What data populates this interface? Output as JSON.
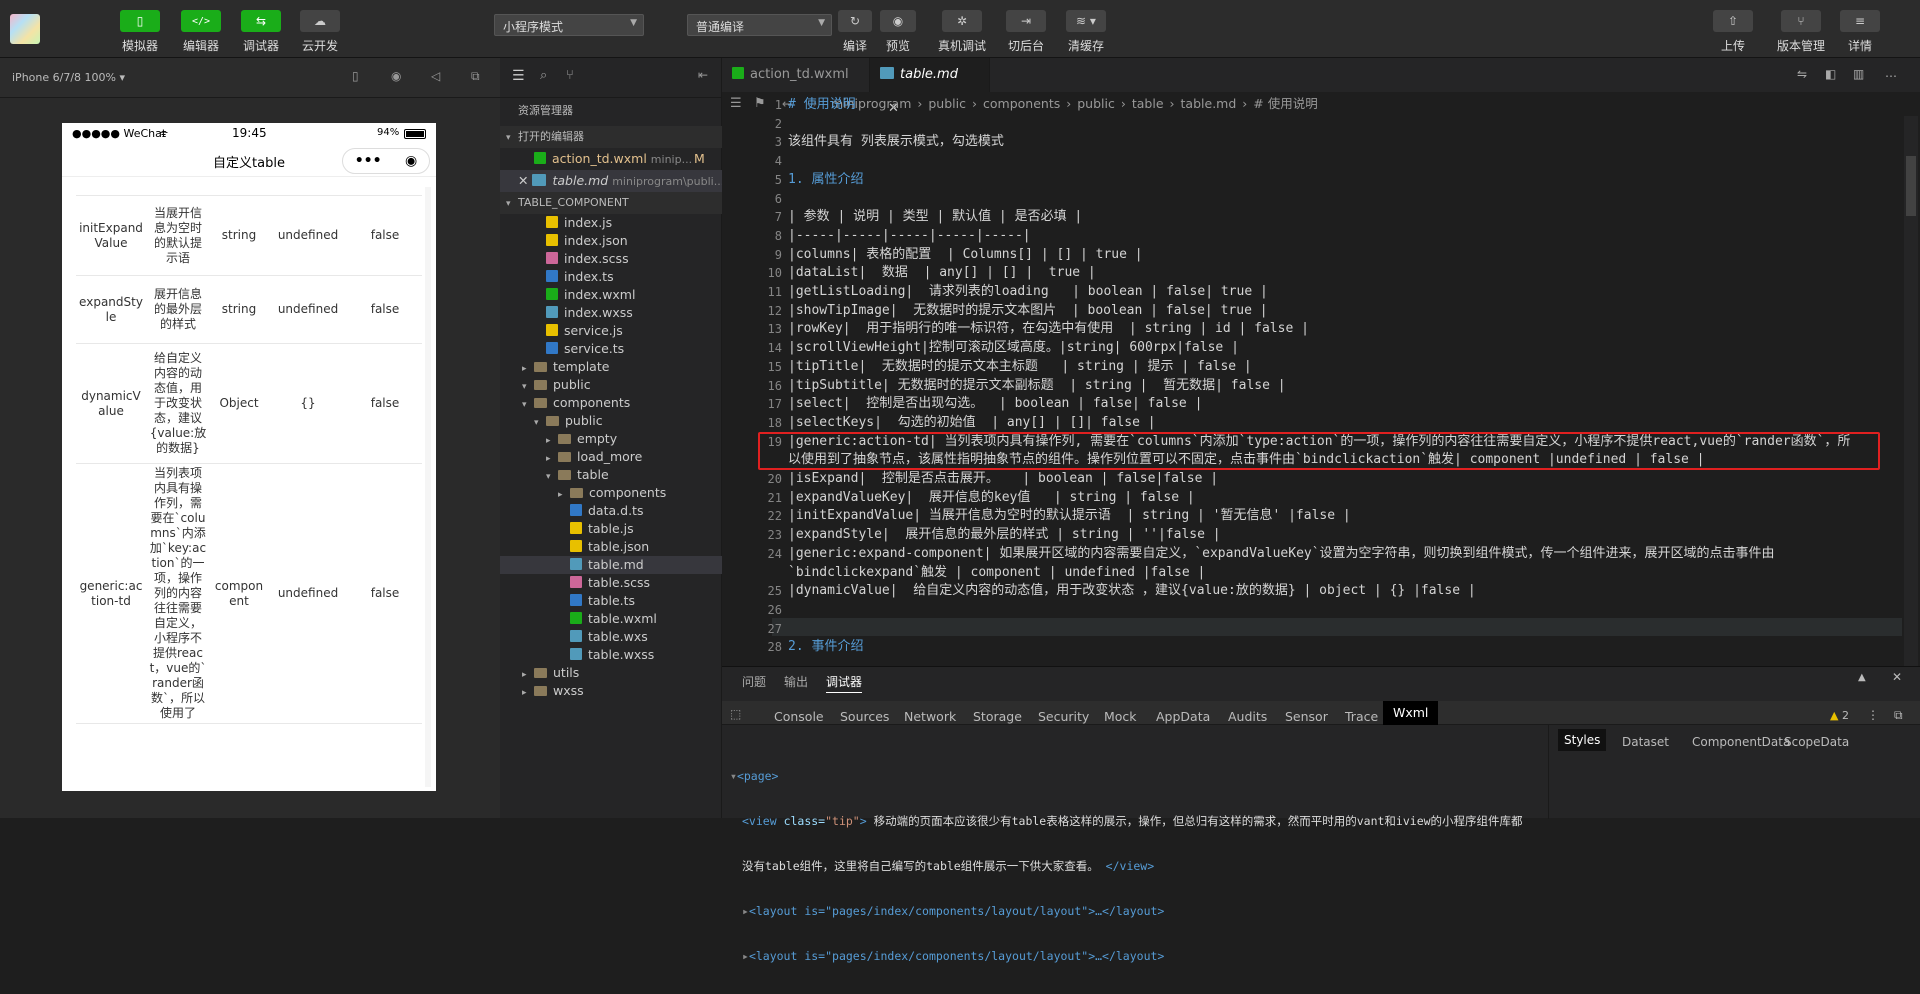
{
  "toolbar": {
    "simulator": "模拟器",
    "editor": "编辑器",
    "debugger": "调试器",
    "cloud": "云开发",
    "mode_select": "小程序模式",
    "compile_select": "普通编译",
    "compile": "编译",
    "preview": "预览",
    "real_debug": "真机调试",
    "background": "切后台",
    "clear_cache": "清缓存",
    "upload": "上传",
    "version": "版本管理",
    "details": "详情"
  },
  "simulator": {
    "device": "iPhone 6/7/8 100% ▾",
    "status": {
      "carrier": "●●●●● WeChat",
      "time": "19:45",
      "battery": "94%"
    },
    "nav_title": "自定义table",
    "rows": [
      {
        "name": "initExpandValue",
        "desc": "当展开信息为空时的默认提示语",
        "type": "string",
        "default": "undefined",
        "required": "false"
      },
      {
        "name": "expandStyle",
        "desc": "展开信息的最外层的样式",
        "type": "string",
        "default": "undefined",
        "required": "false"
      },
      {
        "name": "dynamicValue",
        "desc": "给自定义内容的动态值，用于改变状态，建议{value:放的数据}",
        "type": "Object",
        "default": "{}",
        "required": "false"
      },
      {
        "name": "generic:action-td",
        "desc": "当列表项内具有操作列，需要在`columns`内添加`key:action`的一项，操作列的内容往往需要自定义，小程序不提供react，vue的`rander函数`，所以使用了",
        "type": "component",
        "default": "undefined",
        "required": "false"
      }
    ]
  },
  "explorer": {
    "title": "资源管理器",
    "open_editors": "打开的编辑器",
    "open_files": [
      {
        "name": "action_td.wxml",
        "path": "minip...",
        "badge": "M"
      },
      {
        "name": "table.md",
        "path": "miniprogram\\publi..."
      }
    ],
    "project": "TABLE_COMPONENT",
    "tree": [
      "index.js",
      "index.json",
      "index.scss",
      "index.ts",
      "index.wxml",
      "index.wxss",
      "service.js",
      "service.ts",
      "template",
      "public",
      "components",
      "public",
      "empty",
      "load_more",
      "table",
      "components",
      "data.d.ts",
      "table.js",
      "table.json",
      "table.md",
      "table.scss",
      "table.ts",
      "table.wxml",
      "table.wxs",
      "table.wxss",
      "utils",
      "wxss"
    ]
  },
  "editor": {
    "tabs": [
      "action_td.wxml",
      "table.md"
    ],
    "breadcrumb": [
      "miniprogram",
      "public",
      "components",
      "public",
      "table",
      "table.md",
      "# 使用说明"
    ],
    "lines": [
      {
        "n": "1",
        "t": "# 使用说明"
      },
      {
        "n": "2",
        "t": ""
      },
      {
        "n": "3",
        "t": "该组件具有 列表展示模式，勾选模式"
      },
      {
        "n": "4",
        "t": ""
      },
      {
        "n": "5",
        "t": "1. 属性介绍"
      },
      {
        "n": "6",
        "t": ""
      },
      {
        "n": "7",
        "t": "| 参数 | 说明 | 类型 | 默认值 | 是否必填 |"
      },
      {
        "n": "8",
        "t": "|-----|-----|-----|-----|-----|"
      },
      {
        "n": "9",
        "t": "|columns| 表格的配置  | Columns[] | [] | true |"
      },
      {
        "n": "10",
        "t": "|dataList|  数据  | any[] | [] |  true |"
      },
      {
        "n": "11",
        "t": "|getListLoading|  请求列表的loading   | boolean | false| true |"
      },
      {
        "n": "12",
        "t": "|showTipImage|  无数据时的提示文本图片  | boolean | false| true |"
      },
      {
        "n": "13",
        "t": "|rowKey|  用于指明行的唯一标识符，在勾选中有使用  | string | id | false |"
      },
      {
        "n": "14",
        "t": "|scrollViewHeight|控制可滚动区域高度。|string| 600rpx|false |"
      },
      {
        "n": "15",
        "t": "|tipTitle|  无数据时的提示文本主标题   | string | 提示 | false |"
      },
      {
        "n": "16",
        "t": "|tipSubtitle| 无数据时的提示文本副标题  | string |  暂无数据| false |"
      },
      {
        "n": "17",
        "t": "|select|  控制是否出现勾选。  | boolean | false| false |"
      },
      {
        "n": "18",
        "t": "|selectKeys|  勾选的初始值  | any[] | []| false |"
      },
      {
        "n": "19",
        "t": "|generic:action-td| 当列表项内具有操作列, 需要在`columns`内添加`type:action`的一项，操作列的内容往往需要自定义，小程序不提供react,vue的`rander函数`，所"
      },
      {
        "n": "",
        "t": "以使用到了抽象节点，该属性指明抽象节点的组件。操作列位置可以不固定，点击事件由`bindclickaction`触发| component |undefined | false |"
      },
      {
        "n": "20",
        "t": "|isExpand|  控制是否点击展开。   | boolean | false|false |"
      },
      {
        "n": "21",
        "t": "|expandValueKey|  展开信息的key值   | string | false |"
      },
      {
        "n": "22",
        "t": "|initExpandValue| 当展开信息为空时的默认提示语  | string | '暂无信息' |false |"
      },
      {
        "n": "23",
        "t": "|expandStyle|  展开信息的最外层的样式 | string | ''|false |"
      },
      {
        "n": "24",
        "t": "|generic:expand-component| 如果展开区域的内容需要自定义，`expandValueKey`设置为空字符串，则切换到组件模式，传一个组件进来，展开区域的点击事件由"
      },
      {
        "n": "",
        "t": "`bindclickexpand`触发 | component | undefined |false |"
      },
      {
        "n": "25",
        "t": "|dynamicValue|  给自定义内容的动态值，用于改变状态 ，建议{value:放的数据} | object | {} |false |"
      },
      {
        "n": "26",
        "t": ""
      },
      {
        "n": "27",
        "t": ""
      },
      {
        "n": "28",
        "t": "2. 事件介绍"
      }
    ]
  },
  "debug": {
    "panel_tabs": [
      "问题",
      "输出",
      "调试器"
    ],
    "tools": [
      "Console",
      "Sources",
      "Network",
      "Storage",
      "Security",
      "Mock",
      "AppData",
      "Audits",
      "Sensor",
      "Trace",
      "Wxml"
    ],
    "warn_count": "2",
    "side_tabs": [
      "Styles",
      "Dataset",
      "ComponentData",
      "ScopeData"
    ],
    "xml": {
      "page_open": "<page>",
      "view_tag": "<view",
      "view_attr": "class=",
      "view_class": "\"tip\"",
      "view_text": "移动端的页面本应该很少有table表格这样的展示，操作，但总归有这样的需求，然而平时用的vant和iview的小程序组件库都",
      "view_text2": "没有table组件，这里将自己编写的table组件展示一下供大家查看。",
      "view_close": "</view>",
      "layout1": "<layout is=\"pages/index/components/layout/layout\">…</layout>",
      "layout2": "<layout is=\"pages/index/components/layout/layout\">…</layout>"
    }
  }
}
